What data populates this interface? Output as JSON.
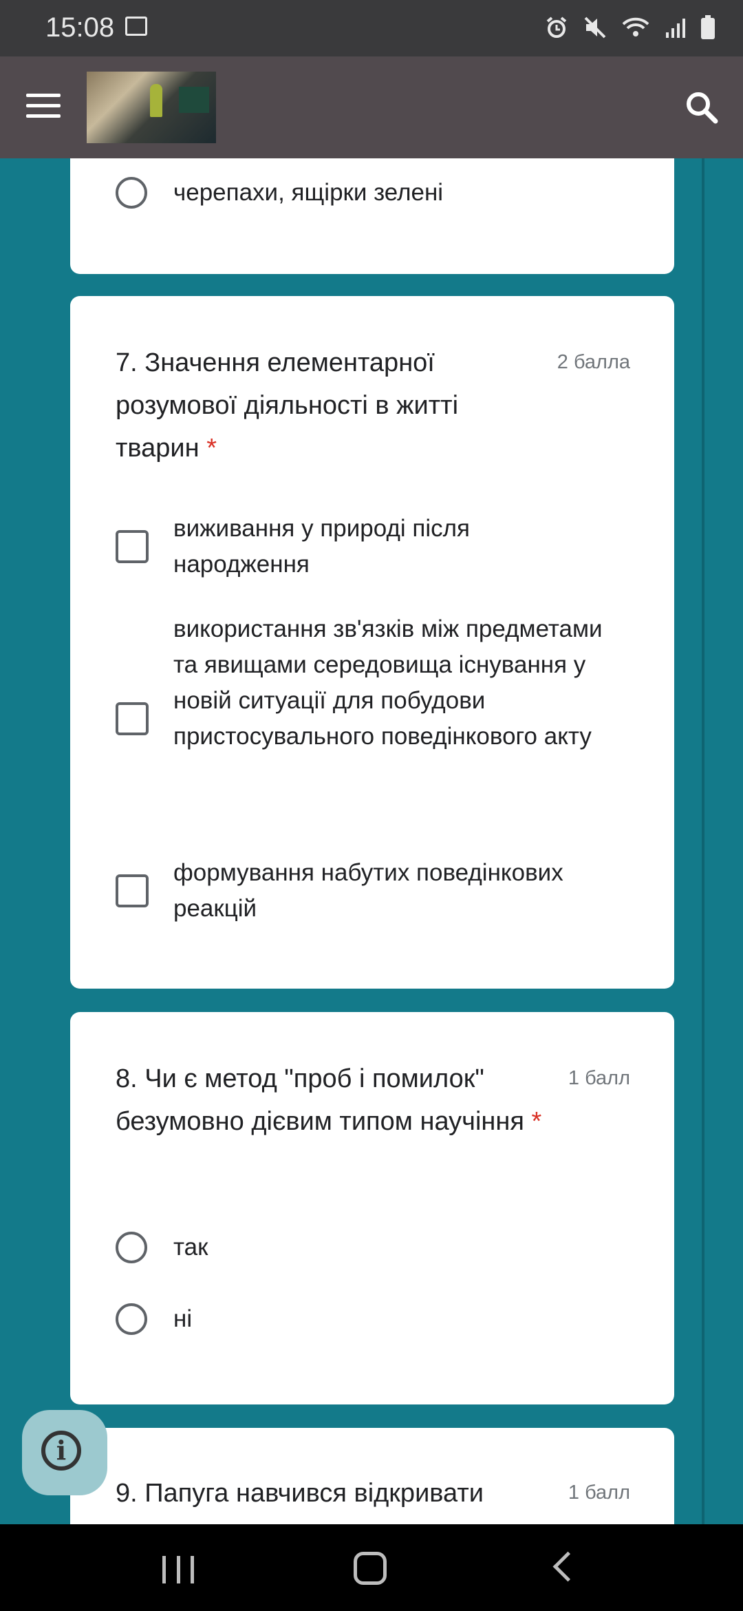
{
  "status_bar": {
    "time": "15:08",
    "icons": [
      "image-icon",
      "alarm-icon",
      "mute-icon",
      "wifi-icon",
      "signal-icon",
      "battery-icon"
    ]
  },
  "app_bar": {
    "menu_icon": "hamburger-icon",
    "header_image": "classroom-photo",
    "search_icon": "search-icon"
  },
  "form": {
    "prev_card": {
      "options": [
        {
          "label": "черепахи, ящірки зелені",
          "type": "radio"
        }
      ]
    },
    "q7": {
      "title": "7. Значення елементарної розумової діяльності в житті тварин",
      "required_mark": "*",
      "points": "2 балла",
      "options": [
        {
          "label": "виживання у природі після народження",
          "type": "checkbox"
        },
        {
          "label": "використання зв'язків між предметами та явищами середовища існування у новій ситуації для побудови пристосувального поведінкового акту",
          "type": "checkbox"
        },
        {
          "label": "формування набутих поведінкових реакцій",
          "type": "checkbox"
        }
      ]
    },
    "q8": {
      "title": "8. Чи є метод \"проб і помилок\" безумовно дієвим типом научіння",
      "required_mark": "*",
      "points": "1 балл",
      "options": [
        {
          "label": "так",
          "type": "radio"
        },
        {
          "label": "ні",
          "type": "radio"
        }
      ]
    },
    "q9": {
      "title": "9. Папуга навчився відкривати",
      "points": "1 балл"
    }
  },
  "info_fab": {
    "icon": "info-icon",
    "glyph": "i"
  },
  "nav_bar": {
    "icons": [
      "recent-apps-icon",
      "home-icon",
      "back-icon"
    ]
  },
  "colors": {
    "background": "#137a8a",
    "app_bar": "#514a4e",
    "status_bar": "#3a3a3c",
    "required": "#d93025"
  }
}
